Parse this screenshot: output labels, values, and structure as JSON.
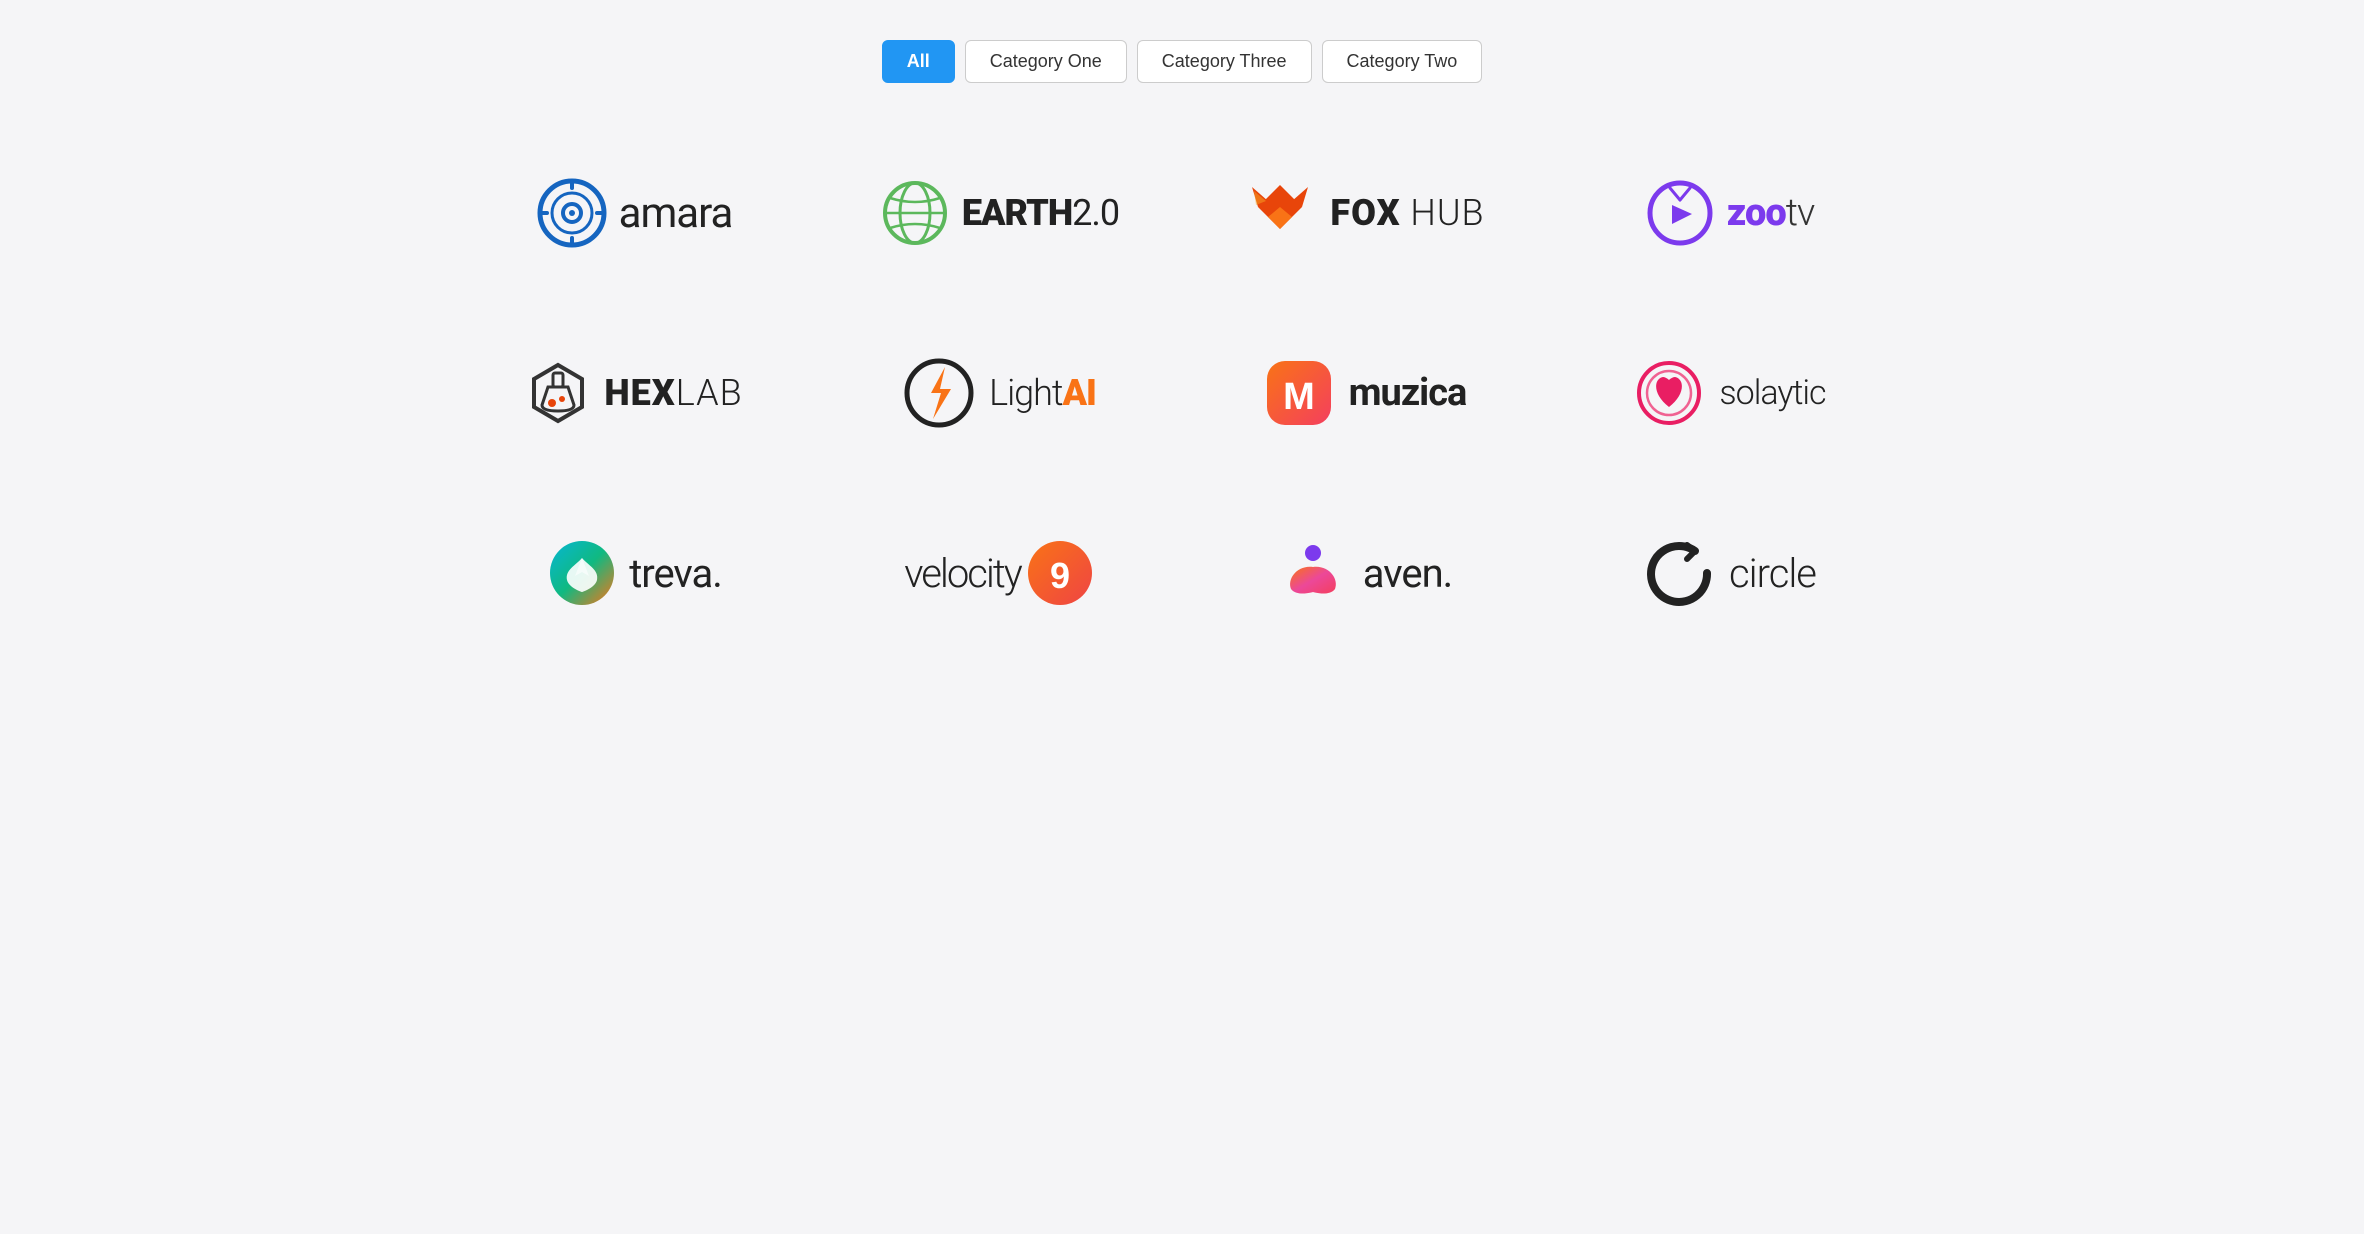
{
  "filters": {
    "buttons": [
      {
        "label": "All",
        "active": true
      },
      {
        "label": "Category One",
        "active": false
      },
      {
        "label": "Category Three",
        "active": false
      },
      {
        "label": "Category Two",
        "active": false
      }
    ]
  },
  "logos": [
    {
      "name": "amara",
      "text": "amara"
    },
    {
      "name": "earth",
      "text": "EARTH2.0"
    },
    {
      "name": "fox",
      "text": "FOX HUB"
    },
    {
      "name": "zoo",
      "text": "zootv"
    },
    {
      "name": "hexlab",
      "text": "HEXLAB"
    },
    {
      "name": "lightai",
      "text": "LightAI"
    },
    {
      "name": "muzica",
      "text": "muzica"
    },
    {
      "name": "solaytic",
      "text": "solaytic"
    },
    {
      "name": "treva",
      "text": "treva."
    },
    {
      "name": "velocity",
      "text": "velocity9"
    },
    {
      "name": "aven",
      "text": "aven."
    },
    {
      "name": "circle",
      "text": "circle"
    }
  ]
}
